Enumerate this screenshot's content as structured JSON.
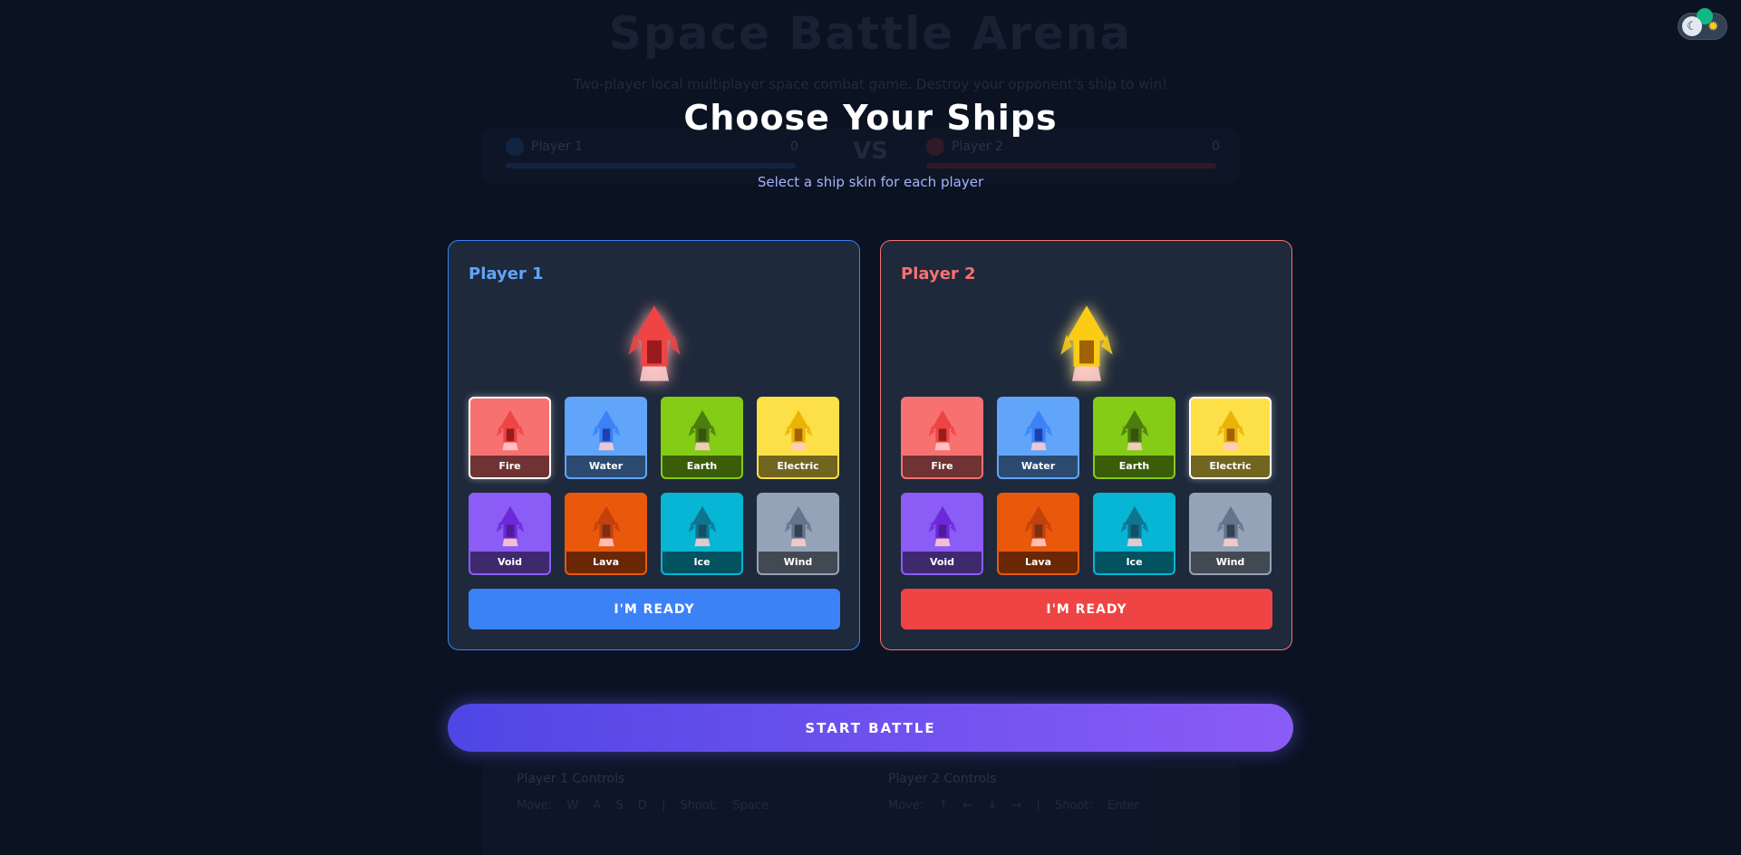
{
  "background": {
    "title": "Space Battle Arena",
    "subtitle": "Two-player local multiplayer space combat game. Destroy your opponent's ship to win!",
    "scoreboard": {
      "player1": "Player 1",
      "player1_score": "0",
      "player2": "Player 2",
      "player2_score": "0",
      "vs": "VS"
    },
    "controls": {
      "player1_title": "Player 1 Controls",
      "player1_keys": "Move: W A S D | Shoot: Space",
      "player2_title": "Player 2 Controls",
      "player2_keys": "Move: ↑ ← ↓ → | Shoot: Enter"
    }
  },
  "theme_toggle": {
    "moon_icon": "moon-icon",
    "sun_icon": "sun-icon"
  },
  "modal": {
    "title": "Choose Your Ships",
    "subtitle": "Select a ship skin for each player",
    "start_button": "START BATTLE"
  },
  "skins": [
    {
      "label": "Fire",
      "bg": "#f87171",
      "ship": "#ef4444",
      "dark": "#991b1b"
    },
    {
      "label": "Water",
      "bg": "#60a5fa",
      "ship": "#3b82f6",
      "dark": "#1e40af"
    },
    {
      "label": "Earth",
      "bg": "#84cc16",
      "ship": "#4d7c0f",
      "dark": "#365314"
    },
    {
      "label": "Electric",
      "bg": "#fde047",
      "ship": "#eab308",
      "dark": "#a16207"
    },
    {
      "label": "Void",
      "bg": "#8b5cf6",
      "ship": "#6d28d9",
      "dark": "#4c1d95"
    },
    {
      "label": "Lava",
      "bg": "#ea580c",
      "ship": "#c2410c",
      "dark": "#7c2d12"
    },
    {
      "label": "Ice",
      "bg": "#06b6d4",
      "ship": "#0e7490",
      "dark": "#164e63"
    },
    {
      "label": "Wind",
      "bg": "#94a3b8",
      "ship": "#64748b",
      "dark": "#334155"
    }
  ],
  "players": [
    {
      "title": "Player 1",
      "selected": "Fire",
      "ready_label": "I'M READY",
      "preview_color": "#ef4444",
      "preview_glow": "#fca5a5"
    },
    {
      "title": "Player 2",
      "selected": "Electric",
      "ready_label": "I'M READY",
      "preview_color": "#facc15",
      "preview_glow": "#fde68a"
    }
  ]
}
